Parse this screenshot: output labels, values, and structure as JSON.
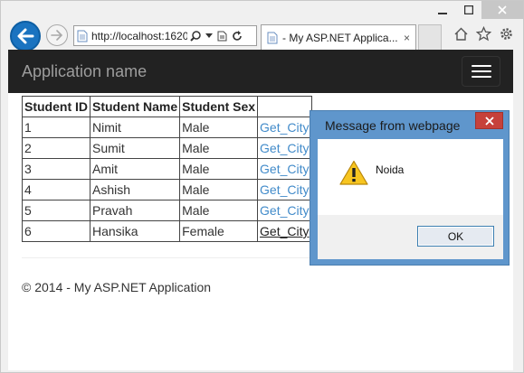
{
  "browser": {
    "address": "http://localhost:1620",
    "tab_title": "- My ASP.NET Applica...",
    "tab_close": "×"
  },
  "page": {
    "brand": "Application name",
    "table": {
      "headers": [
        "Student ID",
        "Student Name",
        "Student Sex",
        ""
      ],
      "rows": [
        [
          "1",
          "Nimit",
          "Male",
          "Get_City"
        ],
        [
          "2",
          "Sumit",
          "Male",
          "Get_City"
        ],
        [
          "3",
          "Amit",
          "Male",
          "Get_City"
        ],
        [
          "4",
          "Ashish",
          "Male",
          "Get_City"
        ],
        [
          "5",
          "Pravah",
          "Male",
          "Get_City"
        ],
        [
          "6",
          "Hansika",
          "Female",
          "Get_City"
        ]
      ]
    },
    "footer": "© 2014 - My ASP.NET Application"
  },
  "dialog": {
    "title": "Message from webpage",
    "message": "Noida",
    "ok_label": "OK"
  },
  "colors": {
    "navbar_bg": "#222222",
    "link": "#428bca",
    "dialog_frame": "#5f96cc",
    "dialog_close": "#c6413b",
    "back_button": "#1a73c0"
  },
  "icons": [
    "back-arrow-icon",
    "forward-arrow-icon",
    "page-icon",
    "search-icon",
    "dropdown-icon",
    "compatibility-icon",
    "refresh-icon",
    "home-icon",
    "favorites-star-icon",
    "settings-gear-icon",
    "warning-icon",
    "close-icon",
    "hamburger-menu-icon"
  ]
}
